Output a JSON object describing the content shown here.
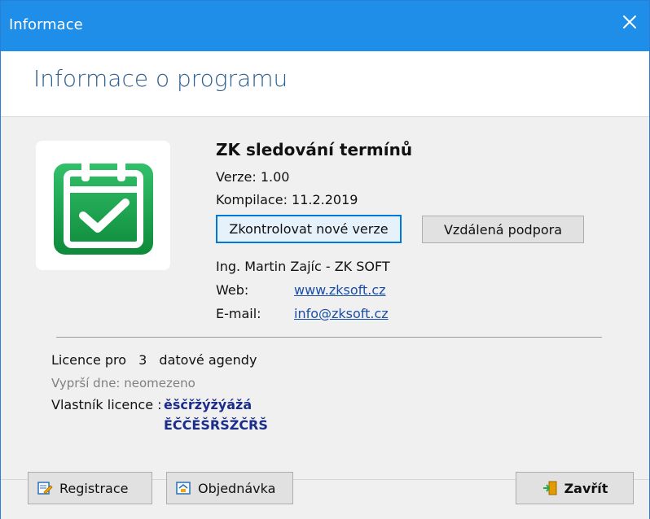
{
  "window": {
    "title": "Informace",
    "close_icon": "close-icon"
  },
  "header": {
    "title": "Informace o programu"
  },
  "app": {
    "name": "ZK sledování termínů",
    "version": "Verze: 1.00",
    "build": "Kompilace: 11.2.2019",
    "check_updates_label": "Zkontrolovat nové verze",
    "remote_support_label": "Vzdálená podpora",
    "company": "Ing. Martin Zajíc - ZK SOFT",
    "web_label": "Web:",
    "web_value": "www.zksoft.cz",
    "email_label": "E-mail:",
    "email_value": "info@zksoft.cz"
  },
  "license": {
    "line1_prefix": "Licence pro",
    "line1_count": "3",
    "line1_suffix": "datové agendy",
    "expires": "Vyprší dne: neomezeno",
    "owner_label": "Vlastník licence :",
    "owner_line1": "ěščřžýžýážá",
    "owner_line2": "ĚČČĚŠŘŠŽČŘŠ"
  },
  "footer": {
    "registration_label": "Registrace",
    "order_label": "Objednávka",
    "close_label": "Zavřít"
  },
  "colors": {
    "titlebar": "#1f8ee8",
    "header_text": "#2b5f8f",
    "link": "#1a4fa8",
    "owner": "#1a2d8a"
  }
}
